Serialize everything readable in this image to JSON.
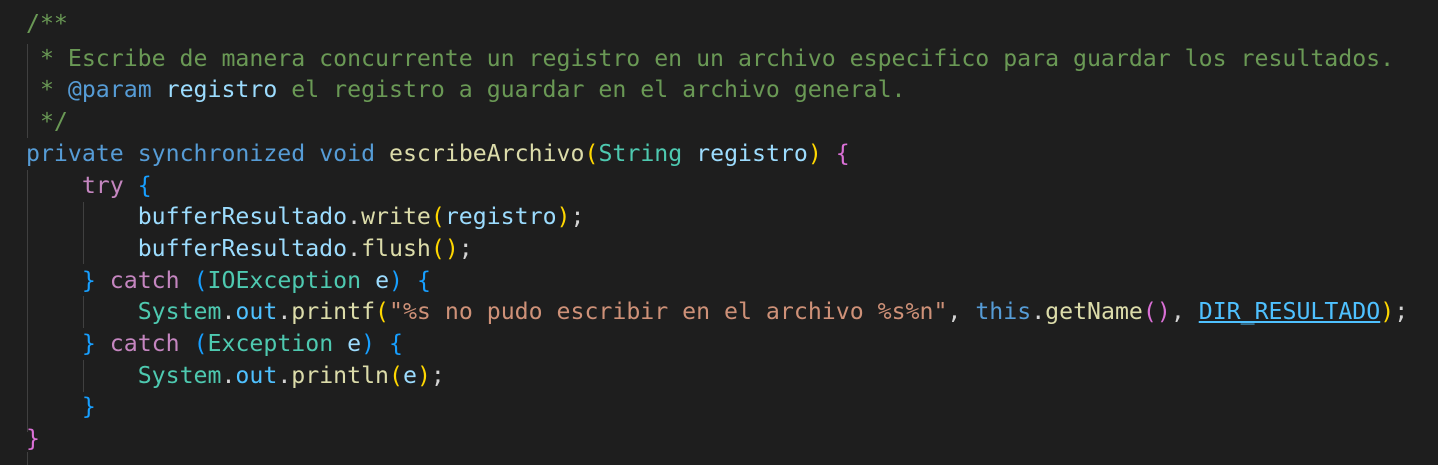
{
  "editor": {
    "colors": {
      "background": "#1e1e1e",
      "comment": "#6a9955",
      "keyword": "#569cd6",
      "control": "#c586c0",
      "type": "#4ec9b0",
      "function": "#dcdcaa",
      "variable": "#9cdcfe",
      "string": "#ce9178",
      "constant": "#4fc1ff",
      "bracket_level_1": "#ffd700",
      "bracket_level_2": "#da70d6",
      "bracket_level_3": "#179fff"
    },
    "code": {
      "doc_open": "/**",
      "doc_line1": " * Escribe de manera concurrente un registro en un archivo especifico para guardar los resultados.",
      "doc_star": " * ",
      "doc_param_tag": "@param",
      "doc_param_name": "registro",
      "doc_param_desc": " el registro a guardar en el archivo general.",
      "doc_close": " */",
      "kw_private": "private",
      "kw_synchronized": "synchronized",
      "kw_void": "void",
      "method_name": "escribeArchivo",
      "param_type": "String",
      "param_name": "registro",
      "kw_try": "try",
      "buffer_var": "bufferResultado",
      "write_fn": "write",
      "flush_fn": "flush",
      "kw_catch": "catch",
      "ioexception_type": "IOException",
      "ex_var": "e",
      "system_type": "System",
      "out_field": "out",
      "printf_fn": "printf",
      "printf_string": "\"%s no pudo escribir en el archivo %s%n\"",
      "kw_this": "this",
      "getname_fn": "getName",
      "dir_const": "DIR_RESULTADO",
      "exception_type": "Exception",
      "println_fn": "println"
    }
  }
}
